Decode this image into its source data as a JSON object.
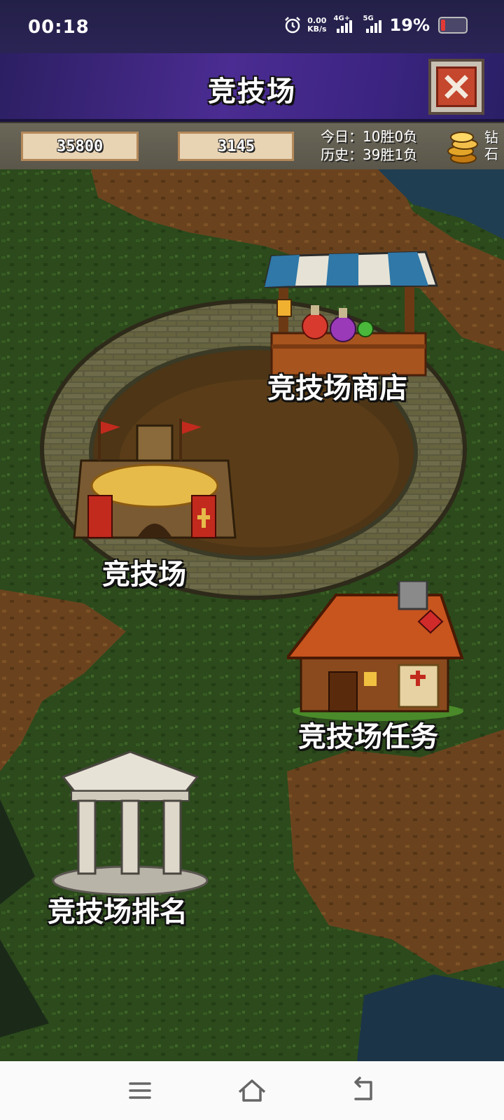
{
  "status_bar": {
    "time": "00:18",
    "net_speed_value": "0.00",
    "net_speed_unit": "KB/s",
    "sim1_tag": "4G+",
    "sim2_tag": "5G",
    "battery_text": "19%",
    "battery_level": 0.19,
    "icons": [
      "alarm-icon",
      "signal-icon",
      "battery-icon"
    ]
  },
  "header": {
    "title": "竞技场",
    "close_icon": "close-icon"
  },
  "resources": {
    "shield_value": "35800",
    "medal_value": "3145",
    "today_record": "今日：10胜0负",
    "history_record": "历史：39胜1负",
    "currency_label": "钻石",
    "icons": [
      "shield-gem-icon",
      "medal-icon",
      "gold-coins-icon"
    ]
  },
  "map": {
    "buildings": [
      {
        "id": "shop",
        "label": "竞技场商店",
        "icon": "market-stall-icon"
      },
      {
        "id": "arena",
        "label": "竞技场",
        "icon": "arena-icon"
      },
      {
        "id": "quests",
        "label": "竞技场任务",
        "icon": "quest-house-icon"
      },
      {
        "id": "ranking",
        "label": "竞技场排名",
        "icon": "temple-icon"
      }
    ]
  },
  "colors": {
    "title_bar": "#4b2c92",
    "resource_pill": "#e8d3b3",
    "grass": "#2d4a1c",
    "dirt": "#6b4420",
    "close_button": "#c4472e"
  },
  "nav_bar": {
    "icons": [
      "menu-icon",
      "home-icon",
      "back-icon"
    ]
  }
}
